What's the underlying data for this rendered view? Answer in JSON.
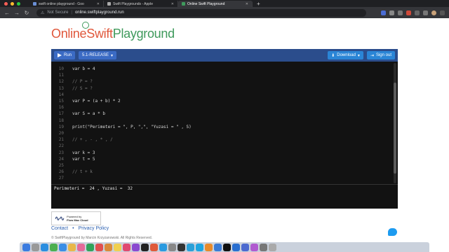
{
  "browser": {
    "tabs": [
      {
        "title": "swift online playground - Goo",
        "active": false
      },
      {
        "title": "Swift Playgrounds - Apple",
        "active": false
      },
      {
        "title": "Online Swift Playground",
        "active": true
      }
    ],
    "new_tab": "+",
    "security": "Not Secure",
    "url": "online.swiftplayground.run"
  },
  "logo": {
    "part1": "Online",
    "part2": "Swift",
    "part3": "Playground"
  },
  "toolbar": {
    "run_label": "Run",
    "version_label": "5.1-RELEASE",
    "download_label": "Download",
    "signout_label": "Sign out"
  },
  "code": {
    "lines": [
      {
        "n": "10",
        "t": "var b = 4",
        "comment": false
      },
      {
        "n": "11",
        "t": "",
        "comment": false
      },
      {
        "n": "12",
        "t": "// P = ?",
        "comment": true
      },
      {
        "n": "13",
        "t": "// S = ?",
        "comment": true
      },
      {
        "n": "14",
        "t": "",
        "comment": false
      },
      {
        "n": "15",
        "t": "var P = (a + b) * 2",
        "comment": false
      },
      {
        "n": "16",
        "t": "",
        "comment": false
      },
      {
        "n": "17",
        "t": "var S = a * b",
        "comment": false
      },
      {
        "n": "18",
        "t": "",
        "comment": false
      },
      {
        "n": "19",
        "t": "print(\"Perimeteri = \", P, \",\", \"Yuzasi = \" , S)",
        "comment": false
      },
      {
        "n": "20",
        "t": "",
        "comment": false
      },
      {
        "n": "21",
        "t": "// + , - , * , /",
        "comment": true
      },
      {
        "n": "22",
        "t": "",
        "comment": false
      },
      {
        "n": "23",
        "t": "var k = 3",
        "comment": false
      },
      {
        "n": "24",
        "t": "var t = 5",
        "comment": false
      },
      {
        "n": "25",
        "t": "",
        "comment": false
      },
      {
        "n": "26",
        "t": "// t + k",
        "comment": true
      },
      {
        "n": "27",
        "t": "",
        "comment": false
      }
    ]
  },
  "output": {
    "text": "Perimeteri =  24 , Yuzasi =  32"
  },
  "footer": {
    "badge_line1": "Powered by",
    "badge_line2": "Flow Mac Cloud",
    "contact": "Contact",
    "dot": "•",
    "privacy": "Privacy Policy",
    "copyright": "© SwiftPlayground by Marcin Krzyzanowski. All Rights Reserved."
  }
}
